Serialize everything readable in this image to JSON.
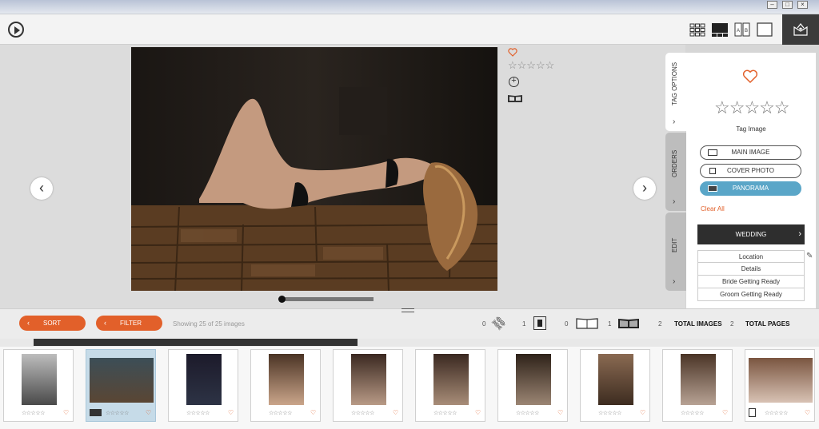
{
  "toolbar": {
    "view_modes": [
      "grid-icon",
      "filmstrip-icon",
      "compare-icon",
      "single-icon"
    ],
    "compare_label": "A B"
  },
  "panel": {
    "tabs": [
      "TAG OPTIONS",
      "ORDERS",
      "EDIT"
    ],
    "tag_label": "Tag Image",
    "main_image": "MAIN IMAGE",
    "cover_photo": "COVER PHOTO",
    "panorama": "PANORAMA",
    "clear_all": "Clear All",
    "category": "WEDDING",
    "subcategories": [
      "Location",
      "Details",
      "Bride Getting Ready",
      "Groom Getting Ready"
    ],
    "rating": 0
  },
  "preview": {
    "stars": "☆☆☆☆☆"
  },
  "filters": {
    "sort": "SORT",
    "filter": "FILTER",
    "showing": "Showing 25 of 25 images"
  },
  "counts": {
    "links": "0",
    "single": "1",
    "spread_open": "0",
    "spread_full": "1",
    "total_images_value": "2",
    "total_images_label": "TOTAL IMAGES",
    "total_pages_value": "2",
    "total_pages_label": "TOTAL PAGES"
  },
  "thumbs": [
    {
      "stars": "☆☆☆☆☆"
    },
    {
      "stars": "☆☆☆☆☆"
    },
    {
      "stars": "☆☆☆☆☆"
    },
    {
      "stars": "☆☆☆☆☆"
    },
    {
      "stars": "☆☆☆☆☆"
    },
    {
      "stars": "☆☆☆☆☆"
    },
    {
      "stars": "☆☆☆☆☆"
    },
    {
      "stars": "☆☆☆☆☆"
    },
    {
      "stars": "☆☆☆☆☆"
    },
    {
      "stars": "☆☆☆☆☆"
    }
  ],
  "colors": {
    "accent": "#e2602a",
    "selected": "#5aa6c8",
    "dark": "#2e2e2e"
  }
}
